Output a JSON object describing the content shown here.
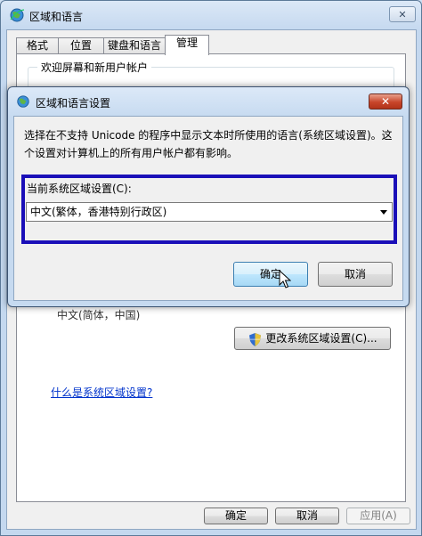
{
  "window": {
    "title": "区域和语言",
    "close_glyph": "✕"
  },
  "tabs": [
    {
      "label": "格式"
    },
    {
      "label": "位置"
    },
    {
      "label": "键盘和语言"
    },
    {
      "label": "管理"
    }
  ],
  "admin": {
    "welcome_group_label": "欢迎屏幕和新用户帐户",
    "current_locale_partial": "中文(简体，中国)",
    "change_locale_button": "更改系统区域设置(C)...",
    "what_is_link": "什么是系统区域设置?"
  },
  "footer": {
    "ok": "确定",
    "cancel": "取消",
    "apply": "应用(A)"
  },
  "dialog": {
    "title": "区域和语言设置",
    "description": "选择在不支持 Unicode 的程序中显示文本时所使用的语言(系统区域设置)。这个设置对计算机上的所有用户帐户都有影响。",
    "current_locale_label": "当前系统区域设置(C):",
    "locale_value": "中文(繁体，香港特别行政区)",
    "ok": "确定",
    "cancel": "取消",
    "close_glyph": "✕"
  },
  "icons": {
    "window": "globe-icon",
    "dialog": "globe-icon",
    "uac": "uac-shield-icon",
    "cursor": "mouse-pointer-icon"
  },
  "colors": {
    "highlight_border": "#1a0fb8",
    "link": "#0033cc",
    "dialog_close": "#c8452a"
  }
}
